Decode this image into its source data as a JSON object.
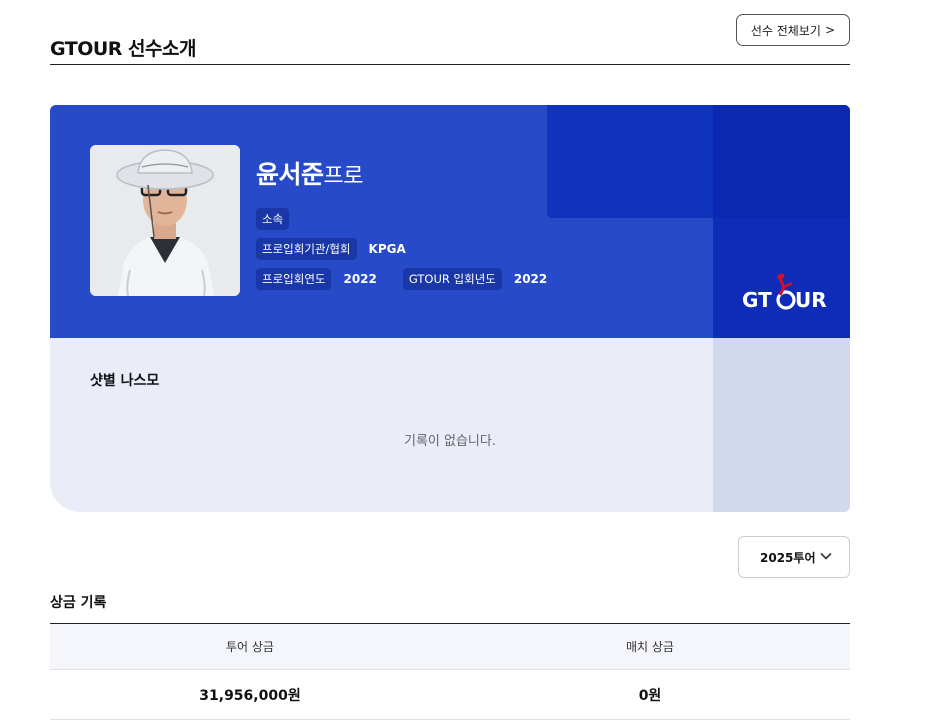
{
  "header": {
    "title": "GTOUR 선수소개",
    "view_all_label": "선수 전체보기",
    "view_all_chevron": ">"
  },
  "player": {
    "name": "윤서준",
    "title_suffix": "프로",
    "affiliation_label": "소속",
    "affiliation_value": "",
    "org_label": "프로입회기관/협회",
    "org_value": "KPGA",
    "join_year_label": "프로입회연도",
    "join_year_value": "2022",
    "gtour_year_label": "GTOUR 입회년도",
    "gtour_year_value": "2022",
    "photo_icon": "player-photo"
  },
  "brand": {
    "logo_text_left": "GT",
    "logo_text_right": "UR",
    "primary": "#274bc8",
    "dark": "#0e2cb8",
    "logo_accent": "#d4102a"
  },
  "stats": {
    "title": "샷별 나스모",
    "empty_text": "기록이 없습니다."
  },
  "season_select": {
    "selected": "2025투어"
  },
  "prize": {
    "title": "상금 기록",
    "columns": [
      "투어 상금",
      "매치 상금"
    ],
    "row": [
      "31,956,000원",
      "0원"
    ]
  }
}
